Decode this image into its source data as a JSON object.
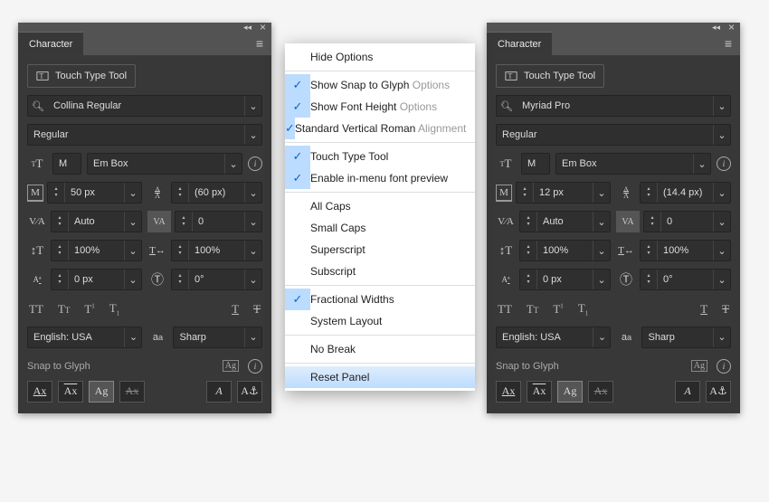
{
  "panel_title": "Character",
  "touch_type_label": "Touch Type Tool",
  "left": {
    "font_family": "Collina Regular",
    "font_style": "Regular",
    "ref_glyph": "M",
    "height_ref": "Em Box",
    "font_size": "50 px",
    "leading": "(60 px)",
    "kerning": "Auto",
    "tracking": "0",
    "vscale": "100%",
    "hscale": "100%",
    "baseline": "0 px",
    "rotation": "0°",
    "language": "English: USA",
    "aa": "Sharp",
    "snap_label": "Snap to Glyph"
  },
  "right": {
    "font_family": "Myriad Pro",
    "font_style": "Regular",
    "ref_glyph": "M",
    "height_ref": "Em Box",
    "font_size": "12 px",
    "leading": "(14.4 px)",
    "kerning": "Auto",
    "tracking": "0",
    "vscale": "100%",
    "hscale": "100%",
    "baseline": "0 px",
    "rotation": "0°",
    "language": "English: USA",
    "aa": "Sharp",
    "snap_label": "Snap to Glyph"
  },
  "menu": {
    "hide_options": "Hide Options",
    "snap_glyph": "Show Snap to Glyph ",
    "snap_glyph_grey": "Options",
    "font_height": "Show Font Height ",
    "font_height_grey": "Options",
    "vert_roman": "Standard Vertical Roman ",
    "vert_roman_grey": "Alignment",
    "touch_type": "Touch Type Tool",
    "inmenu": "Enable in-menu font preview",
    "all_caps": "All Caps",
    "small_caps": "Small Caps",
    "superscript": "Superscript",
    "subscript": "Subscript",
    "fractional": "Fractional Widths",
    "system_layout": "System Layout",
    "no_break": "No Break",
    "reset": "Reset Panel"
  }
}
